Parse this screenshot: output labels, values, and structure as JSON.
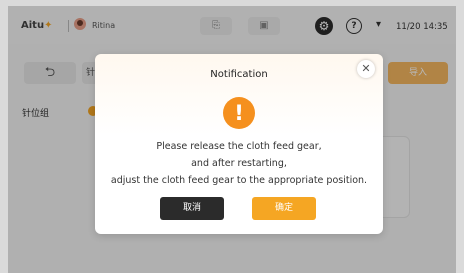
{
  "topbar": {
    "logo_text": "Aitu",
    "logo_accent": "✦",
    "username": "Ritina",
    "btn1_icon": "⎘",
    "btn2_icon": "▣",
    "gear_icon": "⚙",
    "help_icon": "?",
    "wifi_icon": "▾",
    "datetime": "11/20 14:35"
  },
  "toolbar": {
    "back_icon": "⮌",
    "search_value": "针",
    "import_label": "导入"
  },
  "content": {
    "group_label": "针位组"
  },
  "dialog": {
    "title": "Notification",
    "close_icon": "✕",
    "warning_icon": "!",
    "message_line1": "Please release the cloth feed gear,",
    "message_line2": "and after restarting,",
    "message_line3": "adjust the cloth feed gear to the appropriate position.",
    "cancel_label": "取消",
    "confirm_label": "确定"
  },
  "colors": {
    "accent": "#f5a623",
    "warning": "#f5901e",
    "dark_button": "#2b2b2b"
  }
}
